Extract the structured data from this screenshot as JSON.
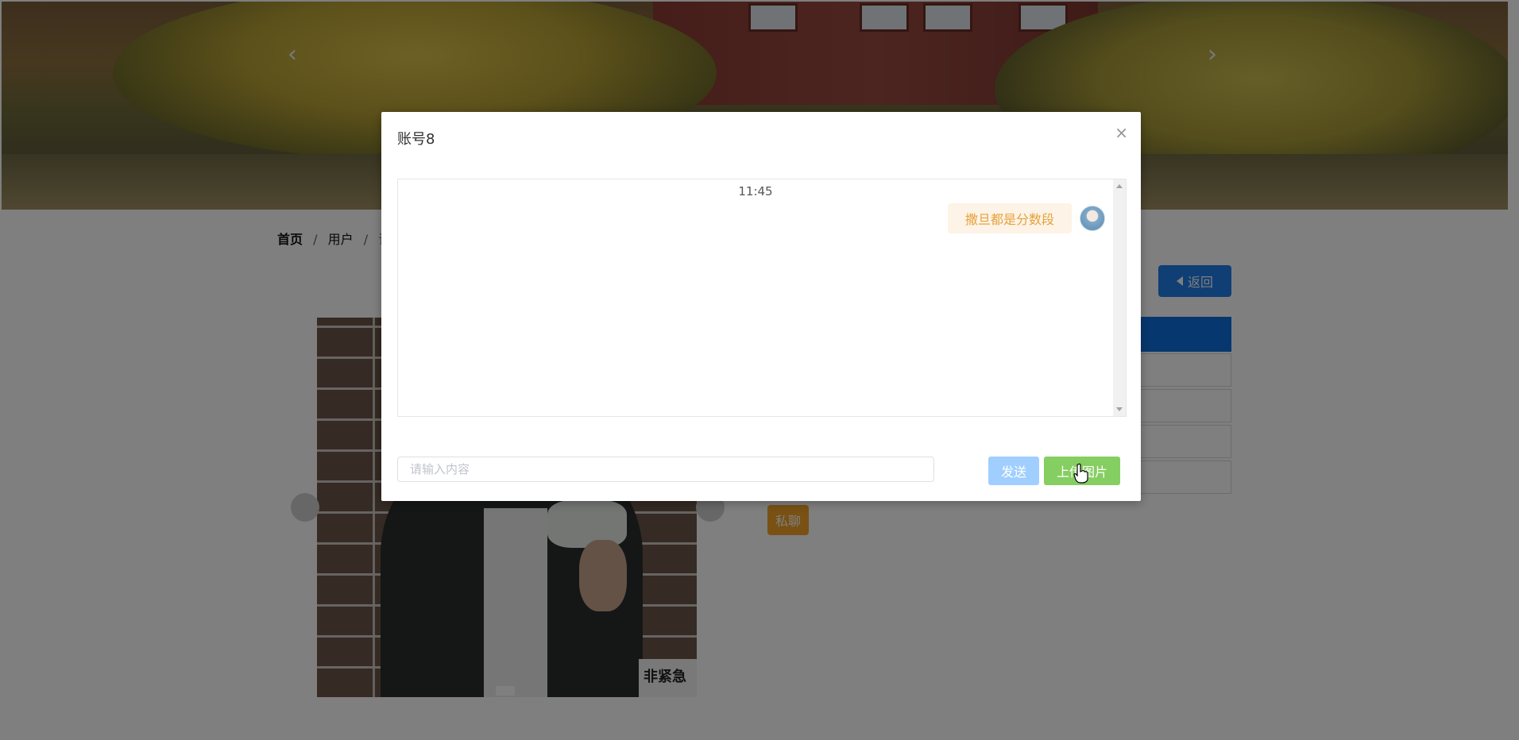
{
  "page": {
    "breadcrumb": [
      "首页",
      "用户",
      "详"
    ],
    "breadcrumb_separator": "/",
    "back_button": "返回",
    "private_chat_button": "私聊",
    "photo_sign_text": "非紧急",
    "banner_prev_icon": "chevron-left-icon",
    "banner_next_icon": "chevron-right-icon"
  },
  "modal": {
    "title": "账号8",
    "close_icon": "close-icon",
    "messages": [
      {
        "time": "11:45",
        "text": "撒旦都是分数段",
        "side": "right"
      }
    ],
    "input_placeholder": "请输入内容",
    "send_button": "发送",
    "upload_button": "上传图片"
  },
  "colors": {
    "primary": "#1e7ee8",
    "send_disabled": "#a0cfff",
    "upload": "#85ce61",
    "bubble_bg": "#fdf3e6",
    "bubble_text": "#e6a23c",
    "private_chat": "#f0a326",
    "overlay": "rgba(0,0,0,0.5)"
  }
}
